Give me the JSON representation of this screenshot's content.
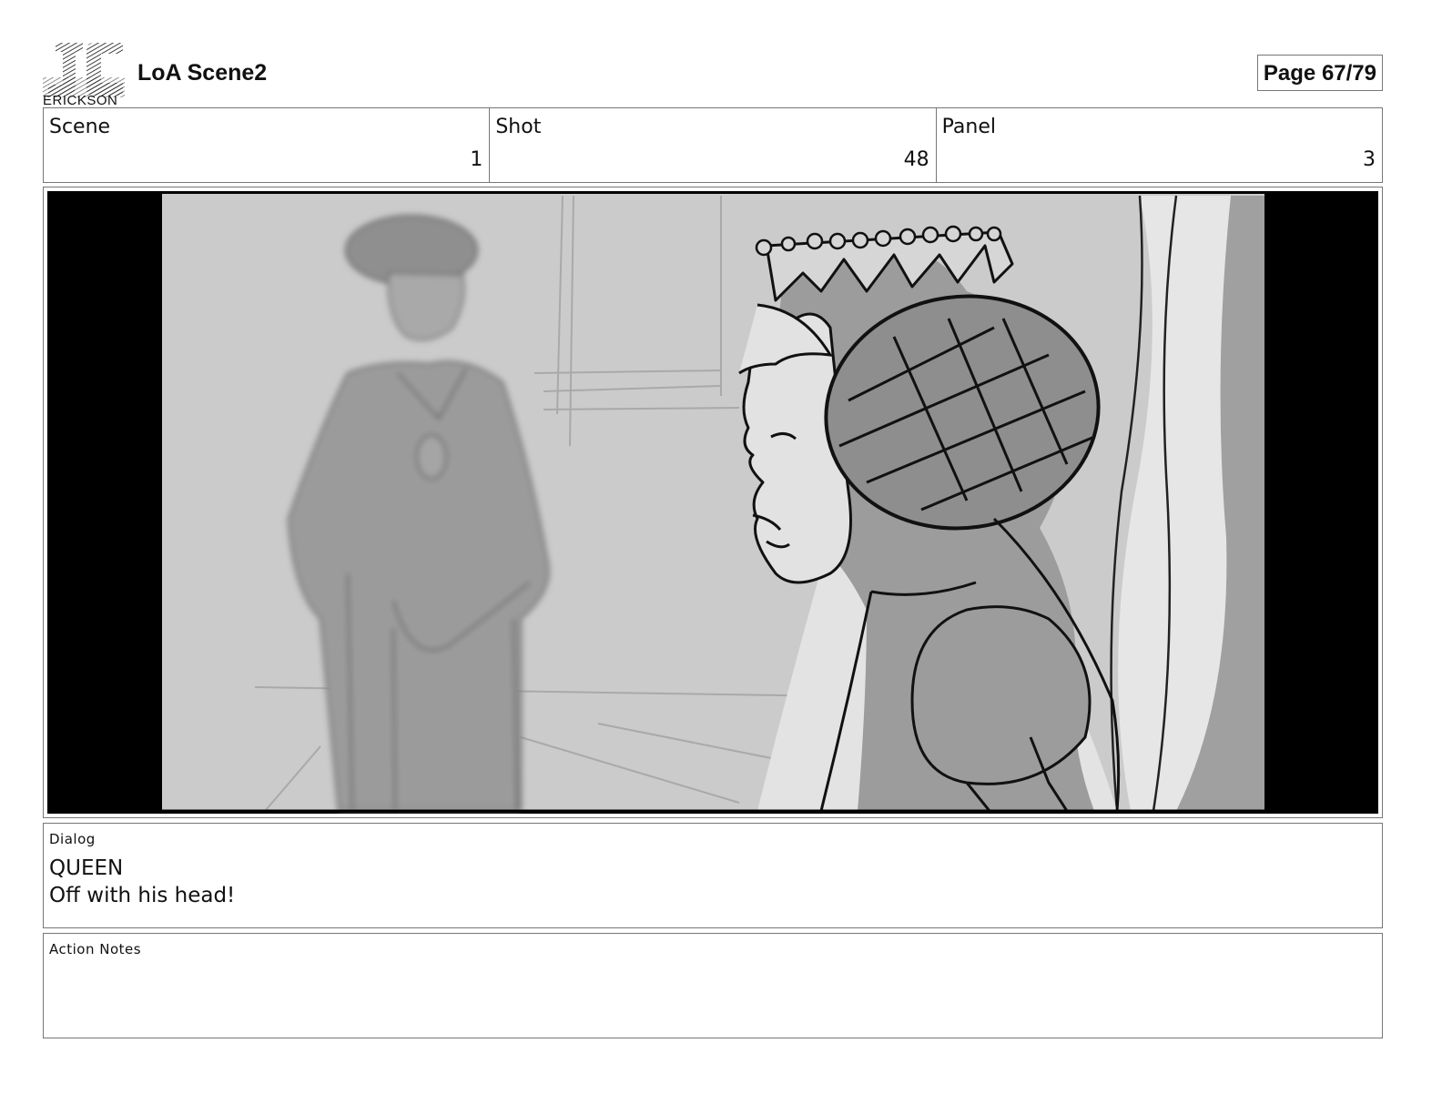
{
  "header": {
    "logo_icon": "jc-erickson-logo",
    "logo_text": "ERICKSON",
    "title": "LoA Scene2",
    "page": "Page 67/79"
  },
  "info": {
    "scene_label": "Scene",
    "scene_value": "1",
    "shot_label": "Shot",
    "shot_value": "48",
    "panel_label": "Panel",
    "panel_value": "3"
  },
  "dialog": {
    "label": "Dialog",
    "speaker": "QUEEN",
    "line": "Off with his head!"
  },
  "action_notes": {
    "label": "Action Notes",
    "text": ""
  }
}
